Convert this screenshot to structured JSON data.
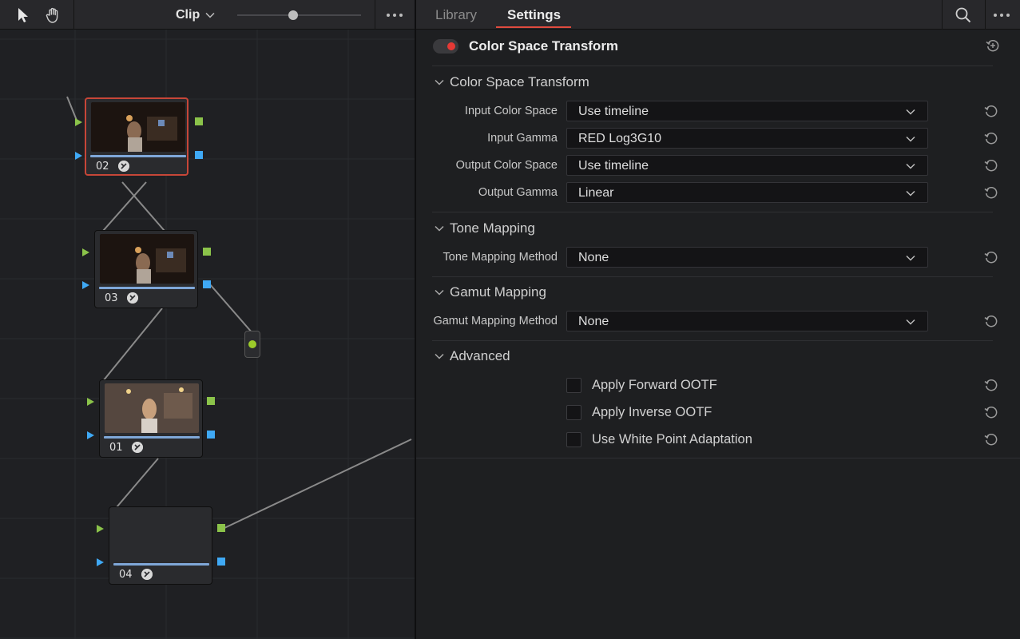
{
  "toolbar": {
    "clip_label": "Clip",
    "zoom_level": 0.45
  },
  "nodes": [
    {
      "id": "02",
      "selected": true
    },
    {
      "id": "03",
      "selected": false
    },
    {
      "id": "01",
      "selected": false
    },
    {
      "id": "04",
      "selected": false
    }
  ],
  "tabs": {
    "library": "Library",
    "settings": "Settings",
    "active": "Settings"
  },
  "effect": {
    "title": "Color Space Transform",
    "enabled": true
  },
  "sections": {
    "cst": "Color Space Transform",
    "tone": "Tone Mapping",
    "gamut": "Gamut Mapping",
    "advanced": "Advanced"
  },
  "fields": {
    "input_color_space": {
      "label": "Input Color Space",
      "value": "Use timeline"
    },
    "input_gamma": {
      "label": "Input Gamma",
      "value": "RED Log3G10"
    },
    "output_color_space": {
      "label": "Output Color Space",
      "value": "Use timeline"
    },
    "output_gamma": {
      "label": "Output Gamma",
      "value": "Linear"
    },
    "tone_mapping_method": {
      "label": "Tone Mapping Method",
      "value": "None"
    },
    "gamut_mapping_method": {
      "label": "Gamut Mapping Method",
      "value": "None"
    }
  },
  "checkboxes": {
    "forward_ootf": {
      "label": "Apply Forward OOTF",
      "checked": false
    },
    "inverse_ootf": {
      "label": "Apply Inverse OOTF",
      "checked": false
    },
    "white_point": {
      "label": "Use White Point Adaptation",
      "checked": false
    }
  },
  "colors": {
    "accent_red": "#e04b3e",
    "port_green": "#8bc34a",
    "port_blue": "#3fa9f5",
    "selected_node_border": "#c74638"
  }
}
